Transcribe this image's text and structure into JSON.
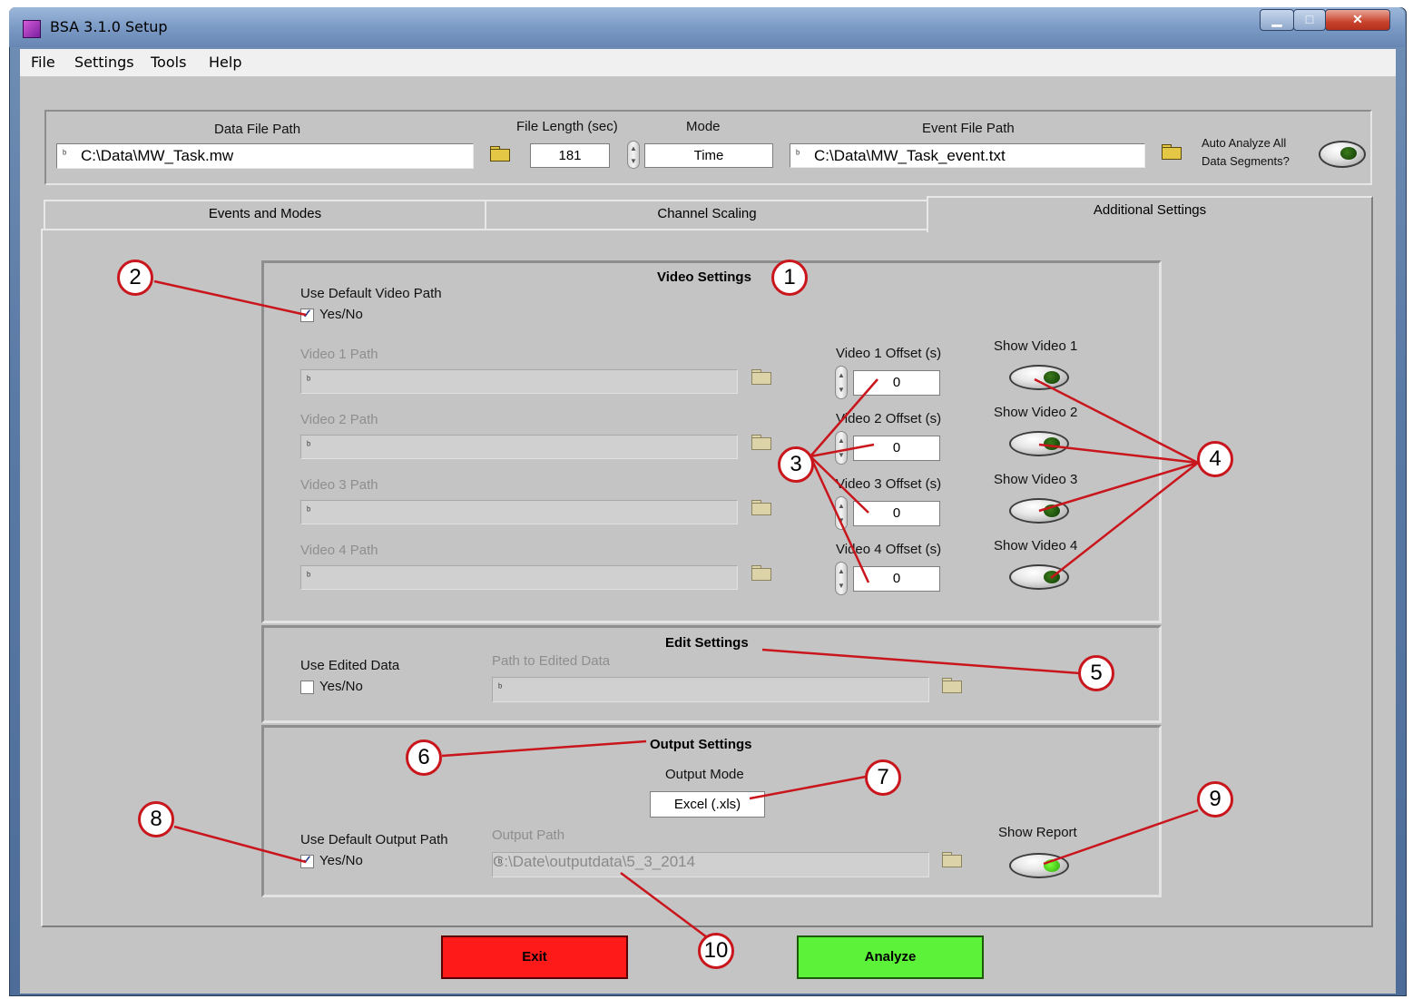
{
  "window": {
    "title": "BSA 3.1.0 Setup",
    "min_glyph": "▁",
    "max_glyph": "□",
    "close_glyph": "✕"
  },
  "menu": [
    "File",
    "Settings",
    "Tools",
    "Help"
  ],
  "top": {
    "data_file_label": "Data File Path",
    "data_file_value": "C:\\Data\\MW_Task.mw",
    "file_length_label": "File Length (sec)",
    "file_length_value": "181",
    "mode_label": "Mode",
    "mode_value": "Time",
    "event_file_label": "Event File Path",
    "event_file_value": "C:\\Data\\MW_Task_event.txt",
    "auto_analyze_label_1": "Auto Analyze All",
    "auto_analyze_label_2": "Data Segments?"
  },
  "tabs": [
    "Events and Modes",
    "Channel Scaling",
    "Additional Settings"
  ],
  "active_tab": "Additional Settings",
  "video": {
    "title": "Video Settings",
    "use_default_label": "Use Default Video Path",
    "use_default_check": "Yes/No",
    "use_default_checked": true,
    "rows": [
      {
        "path_label": "Video 1 Path",
        "offset_label": "Video 1 Offset (s)",
        "offset_value": "0",
        "show_label": "Show Video 1"
      },
      {
        "path_label": "Video 2 Path",
        "offset_label": "Video 2 Offset (s)",
        "offset_value": "0",
        "show_label": "Show Video 2"
      },
      {
        "path_label": "Video 3 Path",
        "offset_label": "Video 3 Offset (s)",
        "offset_value": "0",
        "show_label": "Show Video 3"
      },
      {
        "path_label": "Video 4 Path",
        "offset_label": "Video 4 Offset (s)",
        "offset_value": "0",
        "show_label": "Show Video 4"
      }
    ]
  },
  "edit": {
    "title": "Edit Settings",
    "use_edited_label": "Use Edited Data",
    "use_edited_check": "Yes/No",
    "use_edited_checked": false,
    "path_label": "Path to Edited Data"
  },
  "output": {
    "title": "Output Settings",
    "mode_label": "Output Mode",
    "mode_value": "Excel (.xls)",
    "use_default_label": "Use Default Output Path",
    "use_default_check": "Yes/No",
    "use_default_checked": true,
    "path_label": "Output Path",
    "path_value": "C:\\Date\\outputdata\\5_3_2014",
    "show_report_label": "Show Report"
  },
  "buttons": {
    "exit": "Exit",
    "analyze": "Analyze"
  },
  "callouts": [
    "1",
    "2",
    "3",
    "4",
    "5",
    "6",
    "7",
    "8",
    "9",
    "10"
  ],
  "colors": {
    "callout_ring": "#c9161d",
    "exit_bg": "#ff1a1a",
    "analyze_bg": "#5cf23a",
    "panel_bg": "#c4c4c4"
  }
}
